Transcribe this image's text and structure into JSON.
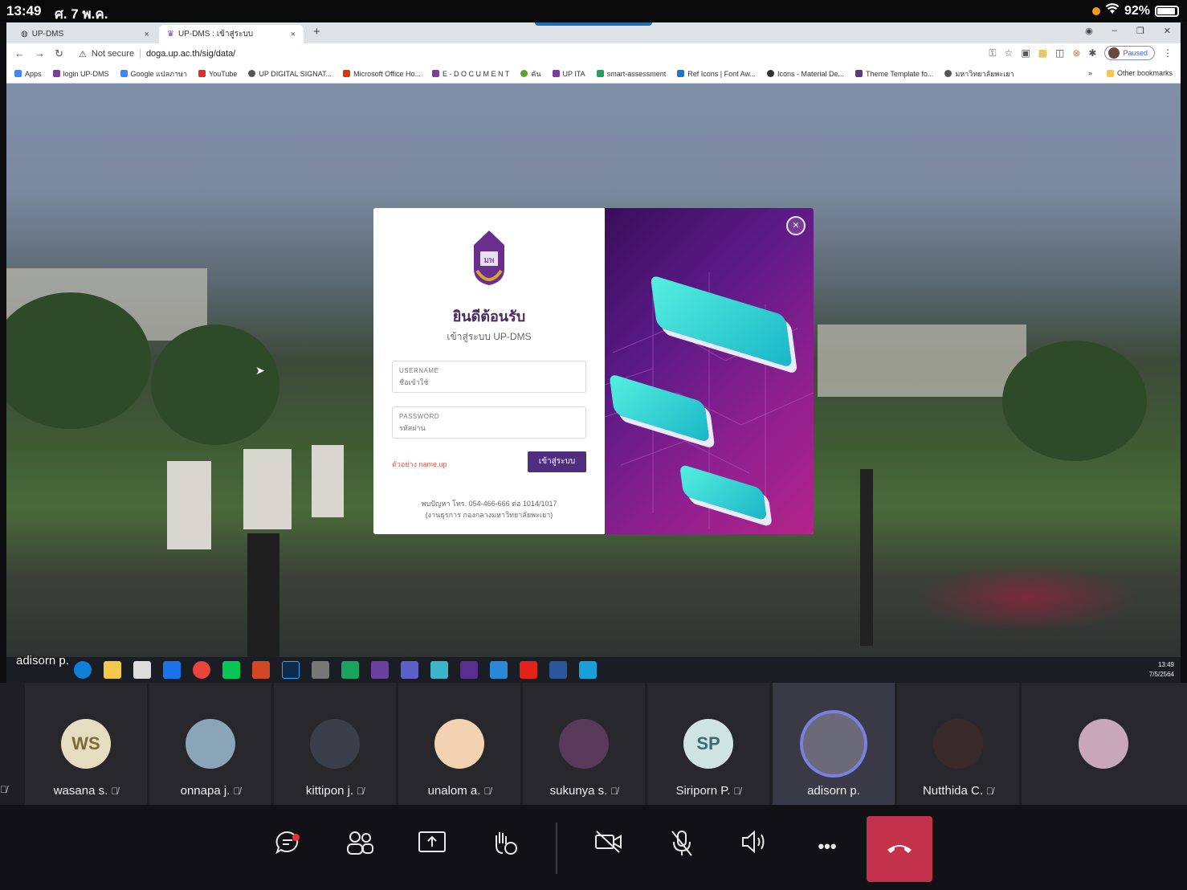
{
  "status_bar": {
    "time": "13:49",
    "date": "ศ. 7 พ.ค.",
    "battery": "92%"
  },
  "browser": {
    "tabs": [
      {
        "label": "UP-DMS",
        "close": "×"
      },
      {
        "label": "UP-DMS : เข้าสู่ระบบ",
        "close": "×"
      }
    ],
    "new_tab": "+",
    "address": {
      "security": "Not secure",
      "url": "doga.up.ac.th/sig/data/"
    },
    "profile_status": "Paused",
    "bookmarks": [
      {
        "label": "Apps",
        "color": "#4285f4"
      },
      {
        "label": "login UP-DMS",
        "color": "#7a3e9c"
      },
      {
        "label": "Google แปลภาษา",
        "color": "#4285f4"
      },
      {
        "label": "YouTube",
        "color": "#e52d27"
      },
      {
        "label": "UP DIGITAL SIGNAT...",
        "color": "#555"
      },
      {
        "label": "Microsoft Office Ho...",
        "color": "#d83b01"
      },
      {
        "label": "E - D O C U M E N T",
        "color": "#7a3e9c"
      },
      {
        "label": "คัน",
        "color": "#5aa332"
      },
      {
        "label": "UP ITA",
        "color": "#7a3e9c"
      },
      {
        "label": "smart-assessment",
        "color": "#1aa260"
      },
      {
        "label": "Ref Icons | Font Aw...",
        "color": "#1976d2"
      },
      {
        "label": "Icons - Material De...",
        "color": "#333"
      },
      {
        "label": "Theme Template fo...",
        "color": "#563d7c"
      },
      {
        "label": "มหาวิทยาลัยพะเยา",
        "color": "#555"
      }
    ],
    "more_bookmarks": "»",
    "other_bookmarks": "Other bookmarks"
  },
  "login_modal": {
    "welcome": "ยินดีต้อนรับ",
    "subtitle": "เข้าสู่ระบบ UP-DMS",
    "username": {
      "label": "USERNAME",
      "placeholder": "ชื่อเข้าใช้"
    },
    "password": {
      "label": "PASSWORD",
      "placeholder": "รหัสผ่าน"
    },
    "hint": "ตัวอย่าง name.up",
    "login_button": "เข้าสู่ระบบ",
    "contact_line1": "พบปัญหา โทร. 054-466-666 ต่อ 1014/1017",
    "contact_line2": "(งานธุรการ กองกลางมหาวิทยาลัยพะเยา)",
    "close": "×",
    "logo_text": "มพ"
  },
  "shared_screen": {
    "presenter": "adisorn p.",
    "clock_time": "13:49",
    "clock_date": "7/5/2564"
  },
  "participants": [
    {
      "name": "wasana s.",
      "initials": "WS",
      "avatar_color": "#e6dcc0",
      "text_color": "#7a6a3a"
    },
    {
      "name": "onnapa j.",
      "initials": "",
      "avatar_color": "#8aa4b8"
    },
    {
      "name": "kittipon j.",
      "initials": "",
      "avatar_color": "#3a3f4a"
    },
    {
      "name": "unalom a.",
      "initials": "",
      "avatar_color": "#f2d2b0"
    },
    {
      "name": "sukunya s.",
      "initials": "",
      "avatar_color": "#5a3a5a"
    },
    {
      "name": "Siriporn P.",
      "initials": "SP",
      "avatar_color": "#cfe3e2",
      "text_color": "#3a6a6a"
    },
    {
      "name": "adisorn p.",
      "initials": "",
      "avatar_color": "#6a6a78",
      "active": true
    },
    {
      "name": "Nutthida C.",
      "initials": "",
      "avatar_color": "#3a2a2a"
    },
    {
      "name": "",
      "initials": "",
      "avatar_color": "#c8a8b8"
    }
  ],
  "controls": {
    "chat": "chat",
    "participants": "people",
    "share": "share",
    "reactions": "raise-hand",
    "camera": "camera-off",
    "mic": "mic-off",
    "speaker": "speaker",
    "more": "•••",
    "hangup": "hang-up"
  }
}
